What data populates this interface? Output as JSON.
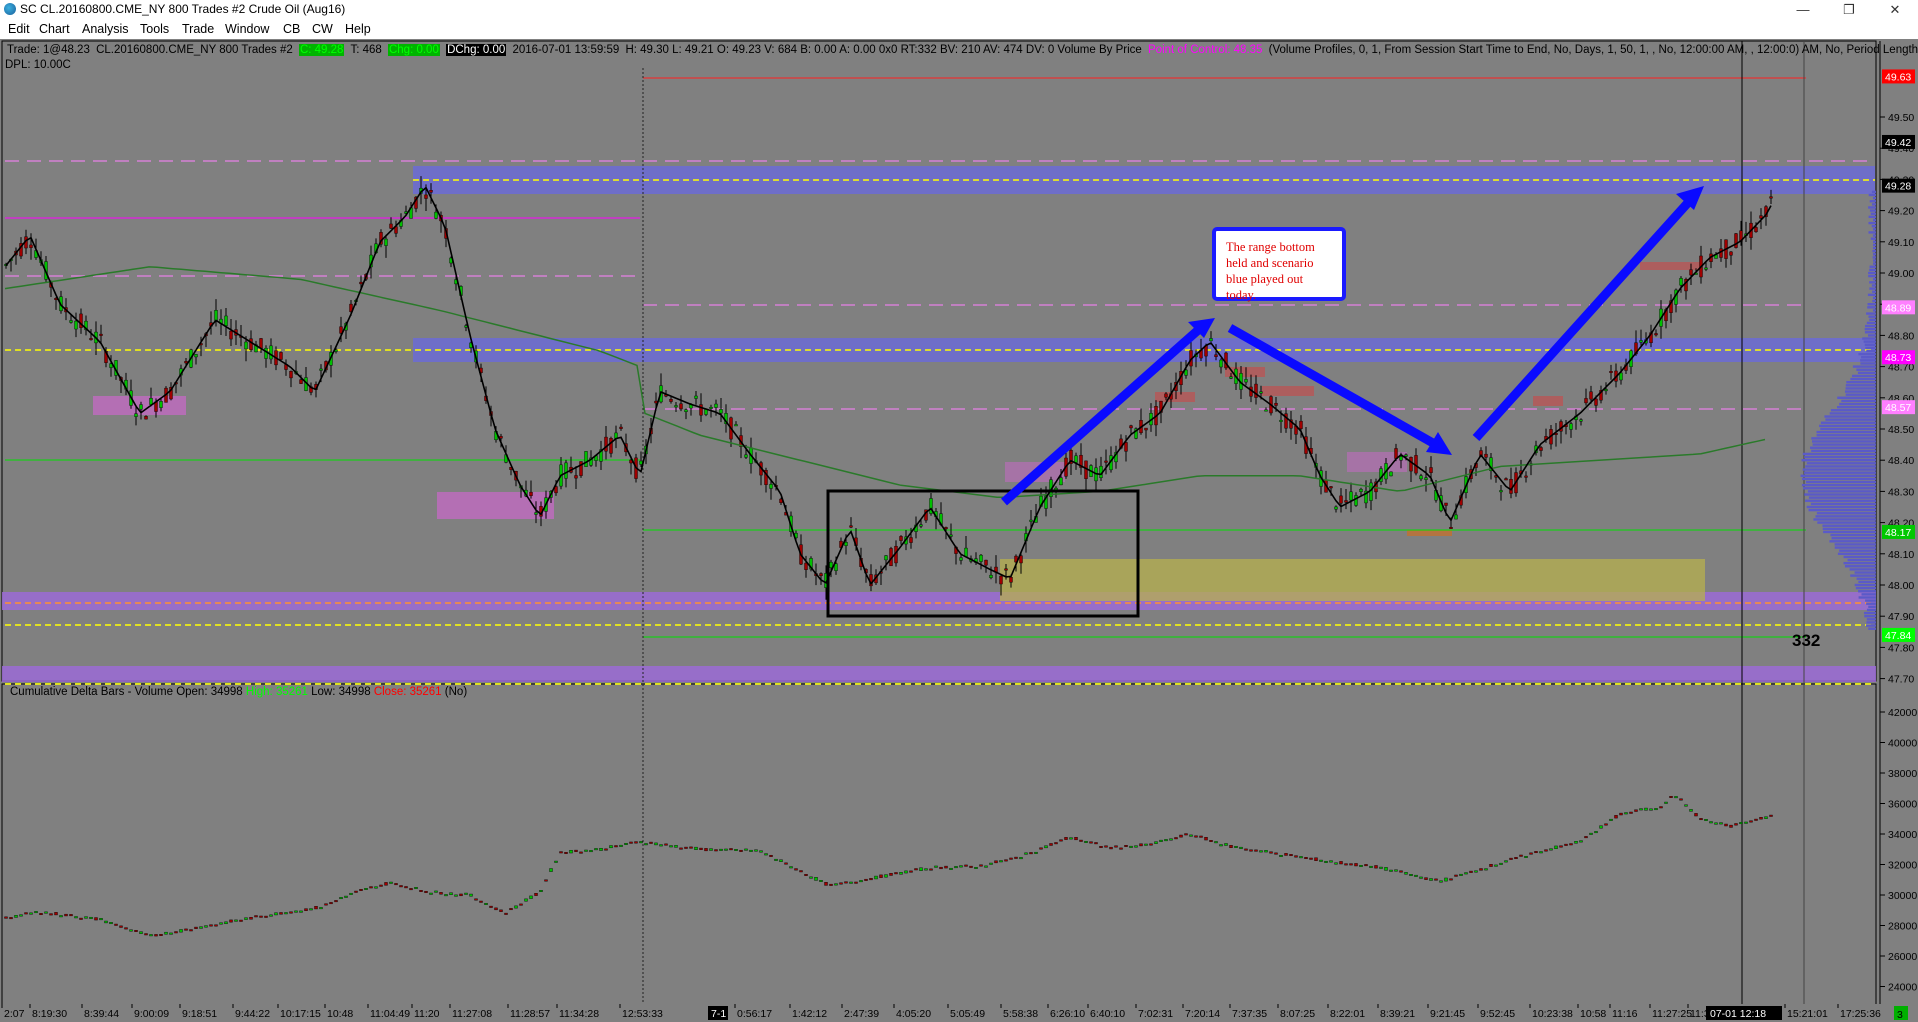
{
  "window": {
    "title": "SC CL.20160800.CME_NY  800 Trades  #2  Crude Oil (Aug16)",
    "minimize_icon": "minimize-icon",
    "restore_icon": "restore-icon",
    "close_icon": "close-icon"
  },
  "menu": [
    "Edit",
    "Chart",
    "Analysis",
    "Tools",
    "Trade",
    "Window",
    "CB",
    "CW",
    "Help"
  ],
  "infobar": {
    "trade": "Trade: 1@48.23",
    "symbol": "CL.20160800.CME_NY  800 Trades  #2",
    "c": "C: 49.28",
    "t": "T: 468",
    "chg": "Chg: 0.00",
    "dchg": "DChg: 0.00",
    "datetime": "2016-07-01  13:59:59",
    "hl": "H: 49.30  L: 49.21  O: 49.23  V: 684  B: 0.00  A: 0.00  0x0  RT:332  BV: 210  AV: 474  DV: 0  Volume By Price",
    "poc_label": "Point of Control: 48.35",
    "profile_desc": "(Volume Profiles, 0, 1, From Session Start Time to End, No, Days, 1, 50, 1, , No, 12:00:00 AM, , 12:00:0) AM, No, Period Length,"
  },
  "dpl": "DPL: 10.00C",
  "delta_title": {
    "name": "Cumulative Delta Bars - Volume",
    "open": "Open: 34998",
    "high": "High: 35261",
    "low": "Low: 34998",
    "close": "Close: 35261",
    "no": "(No)"
  },
  "annotation": "The range bottom held and scenario blue played out today.",
  "count_label": "332",
  "price_axis": [
    "49.50",
    "49.40",
    "49.30",
    "49.20",
    "49.10",
    "49.00",
    "48.90",
    "48.80",
    "48.70",
    "48.60",
    "48.50",
    "48.40",
    "48.30",
    "48.20",
    "48.10",
    "48.00",
    "47.90",
    "47.80",
    "47.70"
  ],
  "price_markers": [
    {
      "text": "49.63",
      "color": "#ff0000",
      "fg": "#ffffff"
    },
    {
      "text": "49.42",
      "color": "#000000",
      "fg": "#ffffff"
    },
    {
      "text": "49.28",
      "color": "#000000",
      "fg": "#ffffff"
    },
    {
      "text": "48.89",
      "color": "#ff7fff",
      "fg": "#ffffff"
    },
    {
      "text": "48.73",
      "color": "#ff00ff",
      "fg": "#ffffff"
    },
    {
      "text": "48.57",
      "color": "#ff7fff",
      "fg": "#ffffff"
    },
    {
      "text": "48.17",
      "color": "#00c800",
      "fg": "#ffffff"
    },
    {
      "text": "47.84",
      "color": "#00ff00",
      "fg": "#ffffff"
    }
  ],
  "delta_axis": [
    "42000",
    "40000",
    "38000",
    "36000",
    "34000",
    "32000",
    "30000",
    "28000",
    "26000",
    "24000"
  ],
  "time_axis": [
    "2:07",
    "8:19:30",
    "8:39:44",
    "9:00:09",
    "9:18:51",
    "9:44:22",
    "10:17:15",
    "10:48",
    "11:04:49",
    "11:20",
    "11:27:08",
    "11:28:57",
    "11:34:28",
    "12:53:33",
    "7-1",
    "0:56:17",
    "1:42:12",
    "2:47:39",
    "4:05:20",
    "5:05:49",
    "5:58:38",
    "6:26:10",
    "6:40:10",
    "7:02:31",
    "7:20:14",
    "7:37:35",
    "8:07:25",
    "8:22:01",
    "8:39:21",
    "9:21:45",
    "9:52:45",
    "10:23:38",
    "10:58",
    "11:16",
    "11:27:25",
    "11:3",
    "07-01  12:18",
    "15:21:01",
    "17:25:36"
  ],
  "corner_label": "3",
  "colors": {
    "background": "#808080",
    "range_band": "#6b6bd6",
    "arrow": "#0a0aff",
    "up_candle": "#00c000",
    "down_candle": "#b00000",
    "ma_black": "#000000",
    "ma_green": "#2a7a2a"
  }
}
